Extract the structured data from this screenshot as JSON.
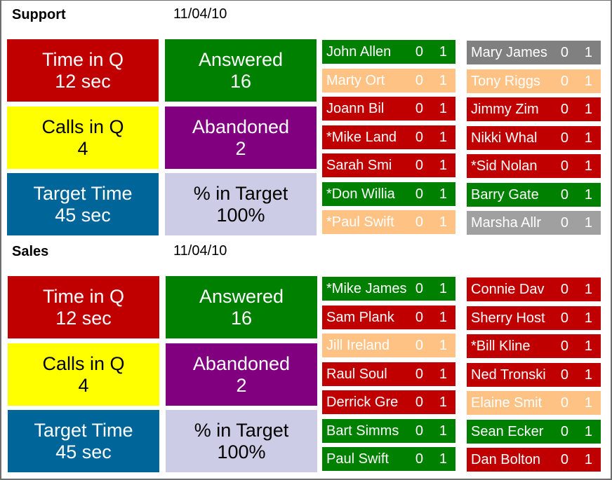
{
  "colors": {
    "red": "#c00000",
    "green": "#008000",
    "yellow": "#ffff00",
    "purple": "#800080",
    "blue": "#006699",
    "lavender": "#ccccE6",
    "peach": "#ffc285",
    "gray_dark": "#808080",
    "gray_light": "#a0a0a0"
  },
  "sections": [
    {
      "title": "Support",
      "date": "11/04/10",
      "tiles": [
        {
          "label": "Time in Q",
          "value": "12 sec",
          "bg": "#c00000",
          "fg": "#ffffff"
        },
        {
          "label": "Answered",
          "value": "16",
          "bg": "#008000",
          "fg": "#ffffff"
        },
        {
          "label": "Calls in Q",
          "value": "4",
          "bg": "#ffff00",
          "fg": "#000000"
        },
        {
          "label": "Abandoned",
          "value": "2",
          "bg": "#800080",
          "fg": "#ffffff"
        },
        {
          "label": "Target Time",
          "value": "45 sec",
          "bg": "#006699",
          "fg": "#ffffff"
        },
        {
          "label": "% in Target",
          "value": "100%",
          "bg": "#ccccE6",
          "fg": "#000000"
        }
      ],
      "agents_left": [
        {
          "name": "John Allen",
          "a": "0",
          "b": "1",
          "status": "green"
        },
        {
          "name": "Marty Ort",
          "a": "0",
          "b": "1",
          "status": "peach"
        },
        {
          "name": "Joann Bil",
          "a": "0",
          "b": "1",
          "status": "red"
        },
        {
          "name": "*Mike Land",
          "a": "0",
          "b": "1",
          "status": "red"
        },
        {
          "name": "Sarah Smi",
          "a": "0",
          "b": "1",
          "status": "red"
        },
        {
          "name": "*Don Willia",
          "a": "0",
          "b": "1",
          "status": "green"
        },
        {
          "name": "*Paul Swift",
          "a": "0",
          "b": "1",
          "status": "peach"
        }
      ],
      "agents_right": [
        {
          "name": "Mary James",
          "a": "0",
          "b": "1",
          "status": "gray_dark"
        },
        {
          "name": "Tony Riggs",
          "a": "0",
          "b": "1",
          "status": "peach"
        },
        {
          "name": "Jimmy Zim",
          "a": "0",
          "b": "1",
          "status": "red"
        },
        {
          "name": "Nikki Whal",
          "a": "0",
          "b": "1",
          "status": "red"
        },
        {
          "name": "*Sid Nolan",
          "a": "0",
          "b": "1",
          "status": "red"
        },
        {
          "name": "Barry Gate",
          "a": "0",
          "b": "1",
          "status": "green"
        },
        {
          "name": "Marsha Allr",
          "a": "0",
          "b": "1",
          "status": "gray_light"
        }
      ]
    },
    {
      "title": "Sales",
      "date": "11/04/10",
      "tiles": [
        {
          "label": "Time in Q",
          "value": "12 sec",
          "bg": "#c00000",
          "fg": "#ffffff"
        },
        {
          "label": "Answered",
          "value": "16",
          "bg": "#008000",
          "fg": "#ffffff"
        },
        {
          "label": "Calls in Q",
          "value": "4",
          "bg": "#ffff00",
          "fg": "#000000"
        },
        {
          "label": "Abandoned",
          "value": "2",
          "bg": "#800080",
          "fg": "#ffffff"
        },
        {
          "label": "Target Time",
          "value": "45 sec",
          "bg": "#006699",
          "fg": "#ffffff"
        },
        {
          "label": "% in Target",
          "value": "100%",
          "bg": "#ccccE6",
          "fg": "#000000"
        }
      ],
      "agents_left": [
        {
          "name": "*Mike James",
          "a": "0",
          "b": "1",
          "status": "green"
        },
        {
          "name": "Sam Plank",
          "a": "0",
          "b": "1",
          "status": "red"
        },
        {
          "name": "Jill Ireland",
          "a": "0",
          "b": "1",
          "status": "peach"
        },
        {
          "name": "Raul Soul",
          "a": "0",
          "b": "1",
          "status": "red"
        },
        {
          "name": "Derrick Gre",
          "a": "0",
          "b": "1",
          "status": "red"
        },
        {
          "name": "Bart Simms",
          "a": "0",
          "b": "1",
          "status": "green"
        },
        {
          "name": "Paul Swift",
          "a": "0",
          "b": "1",
          "status": "green"
        }
      ],
      "agents_right": [
        {
          "name": "Connie Dav",
          "a": "0",
          "b": "1",
          "status": "red"
        },
        {
          "name": "Sherry Host",
          "a": "0",
          "b": "1",
          "status": "red"
        },
        {
          "name": "*Bill Kline",
          "a": "0",
          "b": "1",
          "status": "red"
        },
        {
          "name": "Ned Tronski",
          "a": "0",
          "b": "1",
          "status": "red"
        },
        {
          "name": "Elaine Smit",
          "a": "0",
          "b": "1",
          "status": "peach"
        },
        {
          "name": "Sean Ecker",
          "a": "0",
          "b": "1",
          "status": "green"
        },
        {
          "name": "Dan Bolton",
          "a": "0",
          "b": "1",
          "status": "red"
        }
      ]
    }
  ]
}
